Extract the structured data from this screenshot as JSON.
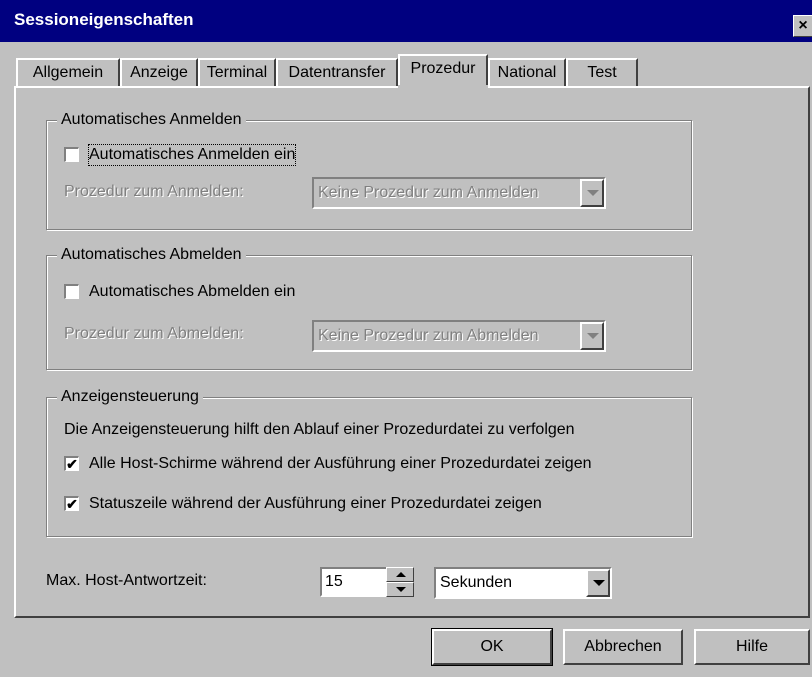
{
  "window": {
    "title": "Sessioneigenschaften",
    "close_glyph": "×"
  },
  "tabs": [
    {
      "label": "Allgemein"
    },
    {
      "label": "Anzeige"
    },
    {
      "label": "Terminal"
    },
    {
      "label": "Datentransfer"
    },
    {
      "label": "Prozedur",
      "active": true
    },
    {
      "label": "National"
    },
    {
      "label": "Test"
    }
  ],
  "auto_logon": {
    "legend": "Automatisches Anmelden",
    "checkbox_label": "Automatisches Anmelden ein",
    "checked": false,
    "proc_label": "Prozedur zum Anmelden:",
    "proc_value": "Keine Prozedur zum Anmelden"
  },
  "auto_logoff": {
    "legend": "Automatisches Abmelden",
    "checkbox_label": "Automatisches Abmelden ein",
    "checked": false,
    "proc_label": "Prozedur zum Abmelden:",
    "proc_value": "Keine Prozedur zum Abmelden"
  },
  "display_control": {
    "legend": "Anzeigensteuerung",
    "description": "Die Anzeigensteuerung hilft den Ablauf einer Prozedurdatei zu verfolgen",
    "option1_label": "Alle Host-Schirme während der Ausführung einer Prozedurdatei zeigen",
    "option1_checked": true,
    "option2_label": "Statuszeile während der Ausführung einer Prozedurdatei zeigen",
    "option2_checked": true
  },
  "host_response": {
    "label": "Max. Host-Antwortzeit:",
    "value": "15",
    "unit": "Sekunden"
  },
  "buttons": {
    "ok": "OK",
    "cancel": "Abbrechen",
    "help": "Hilfe"
  },
  "glyphs": {
    "check": "✔"
  }
}
